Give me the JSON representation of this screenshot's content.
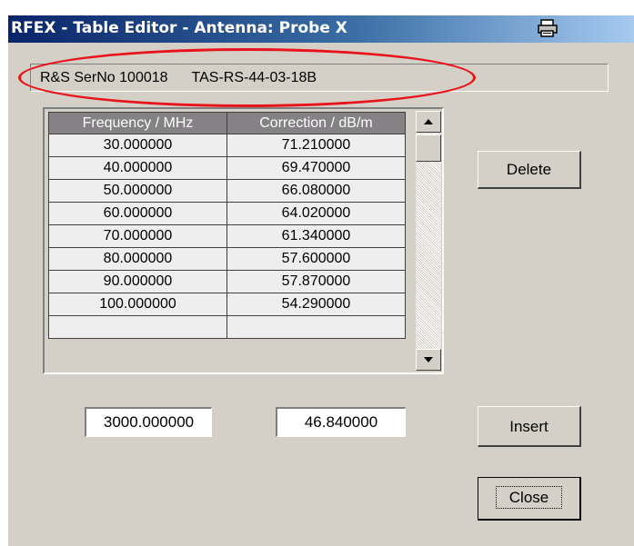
{
  "window": {
    "title": "RFEX - Table Editor - Antenna: Probe X",
    "title_icon": "printer-icon"
  },
  "info": {
    "serial": "R&S SerNo 100018",
    "part": "TAS-RS-44-03-18B"
  },
  "table": {
    "columns": [
      "Frequency / MHz",
      "Correction / dB/m"
    ],
    "rows": [
      [
        "30.000000",
        "71.210000"
      ],
      [
        "40.000000",
        "69.470000"
      ],
      [
        "50.000000",
        "66.080000"
      ],
      [
        "60.000000",
        "64.020000"
      ],
      [
        "70.000000",
        "61.340000"
      ],
      [
        "80.000000",
        "57.600000"
      ],
      [
        "90.000000",
        "57.870000"
      ],
      [
        "100.000000",
        "54.290000"
      ]
    ]
  },
  "inputs": {
    "frequency_value": "3000.000000",
    "correction_value": "46.840000"
  },
  "buttons": {
    "delete": "Delete",
    "insert": "Insert",
    "close": "Close"
  },
  "colors": {
    "highlight": "#e8141c",
    "titlebar": "#0a246a"
  }
}
